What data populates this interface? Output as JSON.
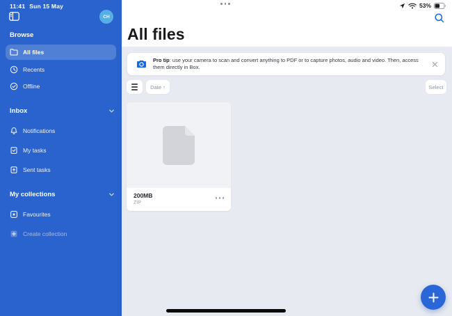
{
  "status_bar": {
    "time": "11:41",
    "date": "Sun 15 May",
    "battery_percent": "53%"
  },
  "sidebar": {
    "avatar_initials": "CH",
    "sections": [
      {
        "header": "Browse",
        "items": [
          {
            "label": "All files",
            "icon": "folder-icon",
            "selected": true
          },
          {
            "label": "Recents",
            "icon": "clock-icon"
          },
          {
            "label": "Offline",
            "icon": "check-circle-icon"
          }
        ]
      },
      {
        "header": "Inbox",
        "items": [
          {
            "label": "Notifications",
            "icon": "bell-icon"
          },
          {
            "label": "My tasks",
            "icon": "task-clipboard-icon"
          },
          {
            "label": "Sent tasks",
            "icon": "sent-clipboard-icon"
          }
        ]
      },
      {
        "header": "My collections",
        "items": [
          {
            "label": "Favourites",
            "icon": "star-square-icon"
          },
          {
            "label": "Create collection",
            "icon": "plus-square-icon"
          }
        ]
      }
    ]
  },
  "main": {
    "title": "All files",
    "pro_tip": {
      "bold": "Pro tip",
      "rest": ": use your camera to scan and convert anything to PDF or to capture photos, audio and video. Then, access them directly in Box."
    },
    "toolbar": {
      "sort_label": "Date ↑",
      "select_label": "Select"
    },
    "files": [
      {
        "name": "200MB",
        "type": "ZIP"
      }
    ]
  },
  "icons": {
    "search": "magnifier",
    "camera": "camera",
    "close": "x",
    "view_toggle": "list-lines",
    "add": "plus",
    "location": "navigation-arrow",
    "wifi": "wifi-arcs",
    "battery": "battery-53"
  },
  "colors": {
    "sidebar_blue": "#2a63cd",
    "selected_row": "rgba(255,255,255,0.18)",
    "accent_blue": "#1668dd",
    "fab_blue": "#2a66d8",
    "avatar_blue": "#57ade5",
    "content_bg": "#e8eaf1"
  }
}
